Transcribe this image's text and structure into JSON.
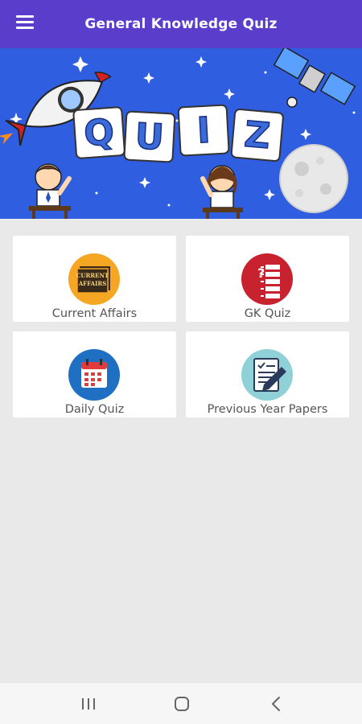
{
  "app_bar": {
    "title": "General Knowledge Quiz",
    "menu_icon": "hamburger-menu-icon",
    "background": "#5a3ecb"
  },
  "banner": {
    "letters": [
      "Q",
      "U",
      "I",
      "Z"
    ]
  },
  "cards": [
    {
      "label": "Current Affairs",
      "icon": "current-affairs-icon",
      "icon_color": "#f5a623",
      "icon_text": [
        "CURRENT",
        "AFFAIRS"
      ]
    },
    {
      "label": "GK Quiz",
      "icon": "quiz-checklist-icon",
      "icon_color": "#c8222f"
    },
    {
      "label": "Daily Quiz",
      "icon": "calendar-icon",
      "icon_color": "#1f6fc2"
    },
    {
      "label": "Previous Year Papers",
      "icon": "papers-pen-icon",
      "icon_color": "#8fd1d6"
    }
  ],
  "navbar": {
    "recents_icon": "recents-icon",
    "home_icon": "home-icon",
    "back_icon": "back-icon"
  }
}
